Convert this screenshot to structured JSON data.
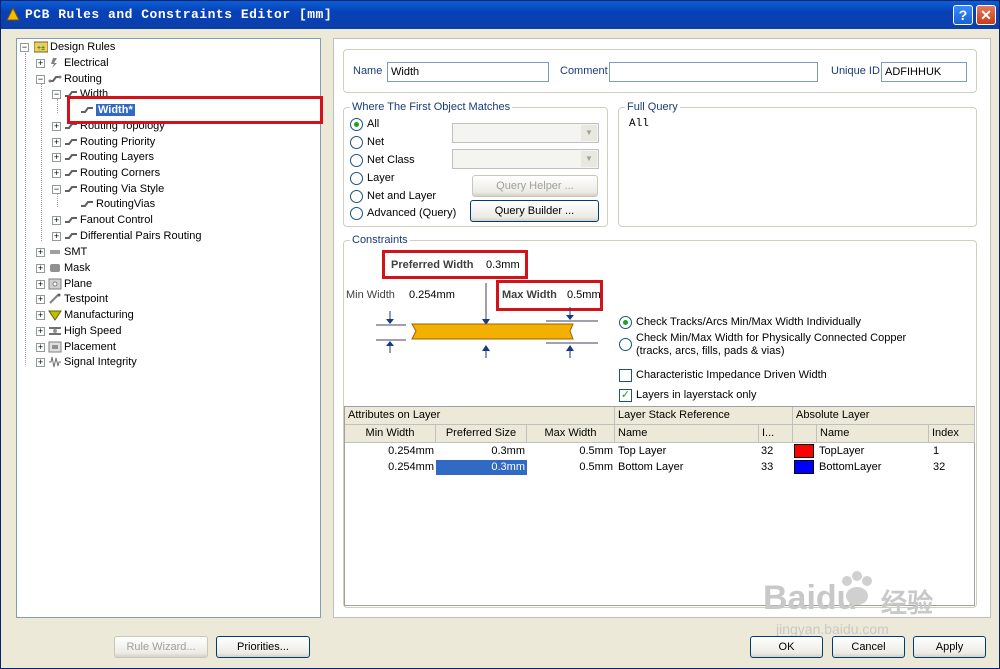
{
  "window": {
    "title": "PCB Rules and Constraints Editor [mm]",
    "help_btn": "?",
    "close_btn": "✕"
  },
  "tree": {
    "root": "Design Rules",
    "electrical": "Electrical",
    "routing": "Routing",
    "width": "Width",
    "width_rule": "Width*",
    "routing_topology": "Routing Topology",
    "routing_priority": "Routing Priority",
    "routing_layers": "Routing Layers",
    "routing_corners": "Routing Corners",
    "routing_via_style": "Routing Via Style",
    "routing_vias": "RoutingVias",
    "fanout_control": "Fanout Control",
    "diff_pairs": "Differential Pairs Routing",
    "smt": "SMT",
    "mask": "Mask",
    "plane": "Plane",
    "testpoint": "Testpoint",
    "manufacturing": "Manufacturing",
    "high_speed": "High Speed",
    "placement": "Placement",
    "signal_integrity": "Signal Integrity"
  },
  "header": {
    "name_label": "Name",
    "name_value": "Width",
    "comment_label": "Comment",
    "comment_value": "",
    "uid_label": "Unique ID",
    "uid_value": "ADFIHHUK"
  },
  "match": {
    "title": "Where The First Object Matches",
    "options": [
      "All",
      "Net",
      "Net Class",
      "Layer",
      "Net and Layer",
      "Advanced (Query)"
    ],
    "selected": "All",
    "query_helper": "Query Helper ...",
    "query_builder": "Query Builder ..."
  },
  "full_query": {
    "title": "Full Query",
    "text": "All"
  },
  "constraints": {
    "title": "Constraints",
    "preferred_label": "Preferred Width",
    "preferred_value": "0.3mm",
    "min_label": "Min Width",
    "min_value": "0.254mm",
    "max_label": "Max Width",
    "max_value": "0.5mm",
    "opt_individual": "Check Tracks/Arcs Min/Max Width Individually",
    "opt_copper_1": "Check Min/Max Width for Physically Connected Copper",
    "opt_copper_2": "(tracks, arcs, fills, pads & vias)",
    "impedance": "Characteristic Impedance Driven Width",
    "layerstack_only": "Layers in layerstack only",
    "check_mark": "✓"
  },
  "grid": {
    "group_attrs": "Attributes on Layer",
    "group_stack": "Layer Stack Reference",
    "group_abs": "Absolute Layer",
    "col_min": "Min Width",
    "col_pref": "Preferred Size",
    "col_max": "Max Width",
    "col_name": "Name",
    "col_idx": "I...",
    "col_abs_name": "Name",
    "col_abs_idx": "Index",
    "rows": [
      {
        "min": "0.254mm",
        "pref": "0.3mm",
        "max": "0.5mm",
        "name": "Top Layer",
        "idx": "32",
        "abs_name": "TopLayer",
        "abs_idx": "1",
        "color": "#ff0000"
      },
      {
        "min": "0.254mm",
        "pref": "0.3mm",
        "max": "0.5mm",
        "name": "Bottom Layer",
        "idx": "33",
        "abs_name": "BottomLayer",
        "abs_idx": "32",
        "color": "#0000ff"
      }
    ]
  },
  "footer": {
    "rule_wizard": "Rule Wizard...",
    "priorities": "Priorities...",
    "ok": "OK",
    "cancel": "Cancel",
    "apply": "Apply"
  },
  "watermark": {
    "brand": "Baidu",
    "cn": "经验",
    "url": "jingyan.baidu.com"
  }
}
